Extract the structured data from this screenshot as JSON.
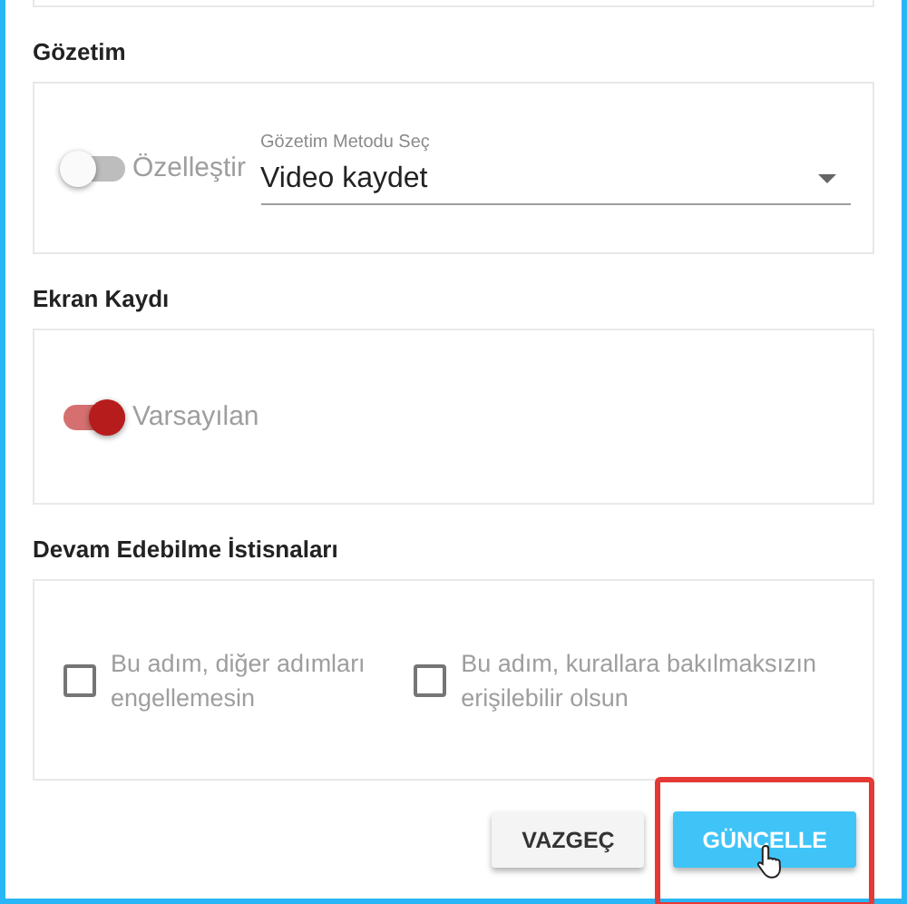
{
  "sections": [
    {
      "kind": "toggle-select",
      "title": "Gözetim",
      "toggle": {
        "label": "Özelleştir",
        "on": false
      },
      "select": {
        "label": "Gözetim Metodu Seç",
        "value": "Video kaydet"
      }
    },
    {
      "kind": "toggle",
      "title": "Ekran Kaydı",
      "toggle": {
        "label": "Varsayılan",
        "on": true
      }
    },
    {
      "kind": "checkboxes",
      "title": "Devam Edebilme İstisnaları",
      "checkboxes": [
        {
          "label": "Bu adım, diğer adımları engellemesin",
          "checked": false
        },
        {
          "label": "Bu adım, kurallara bakılmaksızın erişilebilir olsun",
          "checked": false
        }
      ]
    }
  ],
  "buttons": [
    {
      "label": "VAZGEÇ",
      "kind": "secondary",
      "highlighted": false
    },
    {
      "label": "GÜNCELLE",
      "kind": "primary",
      "highlighted": true
    }
  ]
}
